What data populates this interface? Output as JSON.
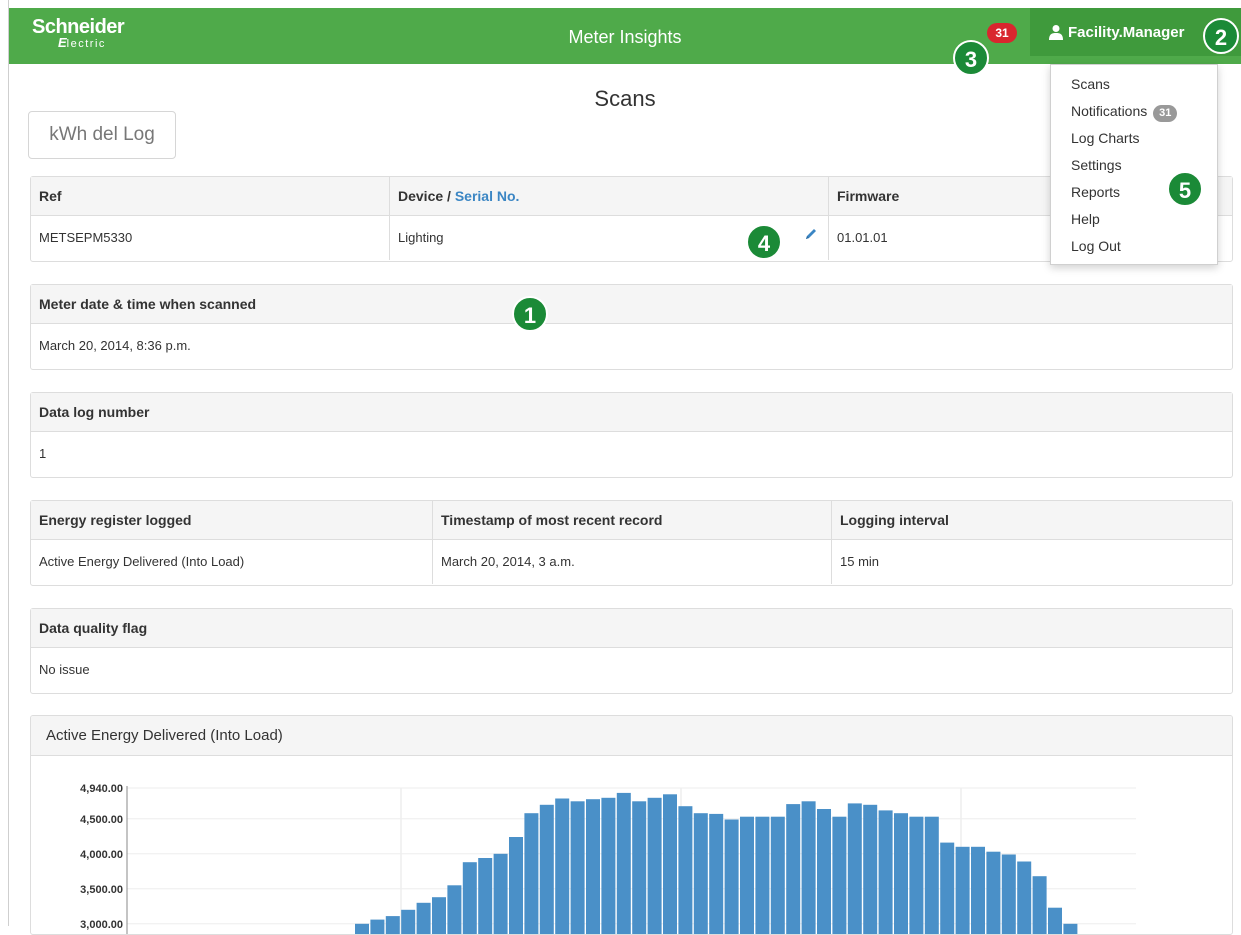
{
  "header": {
    "logo_main": "Schneider",
    "logo_sub_mark": "E",
    "logo_sub_text": "lectric",
    "app_title": "Meter Insights",
    "notification_count": "31",
    "user_name": "Facility.Manager"
  },
  "callouts": [
    "1",
    "2",
    "3",
    "4",
    "5"
  ],
  "menu": {
    "items": [
      {
        "label": "Scans"
      },
      {
        "label": "Notifications",
        "badge": "31"
      },
      {
        "label": "Log Charts"
      },
      {
        "label": "Settings"
      },
      {
        "label": "Reports"
      },
      {
        "label": "Help"
      },
      {
        "label": "Log Out"
      }
    ]
  },
  "page_title": "Scans",
  "log_button_label": "kWh del Log",
  "device_table": {
    "col_ref": "Ref",
    "col_device": "Device / ",
    "col_serial": "Serial No.",
    "col_firmware": "Firmware",
    "ref": "METSEPM5330",
    "device": "Lighting",
    "firmware": "01.01.01"
  },
  "meter_datetime": {
    "label": "Meter date & time when scanned",
    "value": "March 20, 2014, 8:36 p.m."
  },
  "data_log_number": {
    "label": "Data log number",
    "value": "1"
  },
  "energy_table": {
    "col_register": "Energy register logged",
    "col_timestamp": "Timestamp of most recent record",
    "col_interval": "Logging interval",
    "register": "Active Energy Delivered (Into Load)",
    "timestamp": "March 20, 2014, 3 a.m.",
    "interval": "15 min"
  },
  "data_quality": {
    "label": "Data quality flag",
    "value": "No issue"
  },
  "chart_title": "Active Energy Delivered (Into Load)",
  "colors": {
    "brand_green": "#4faa4a",
    "user_green": "#3f9a3c",
    "bar_blue": "#4a90c8",
    "badge_red": "#d9262e"
  },
  "chart_data": {
    "type": "bar",
    "title": "Active Energy Delivered (Into Load)",
    "ylim": [
      2900,
      4940
    ],
    "y_ticks": [
      "4,940.00",
      "4,500.00",
      "4,000.00",
      "3,500.00",
      "3,000.00"
    ],
    "y_tick_values": [
      4940,
      4500,
      4000,
      3500,
      3000
    ],
    "values": [
      3000,
      3060,
      3110,
      3200,
      3300,
      3380,
      3550,
      3880,
      3940,
      4000,
      4240,
      4580,
      4700,
      4790,
      4750,
      4780,
      4800,
      4870,
      4750,
      4800,
      4850,
      4680,
      4580,
      4570,
      4490,
      4530,
      4530,
      4530,
      4710,
      4750,
      4640,
      4530,
      4720,
      4700,
      4620,
      4580,
      4530,
      4530,
      4160,
      4100,
      4100,
      4030,
      3990,
      3890,
      3680,
      3230,
      3000
    ]
  }
}
